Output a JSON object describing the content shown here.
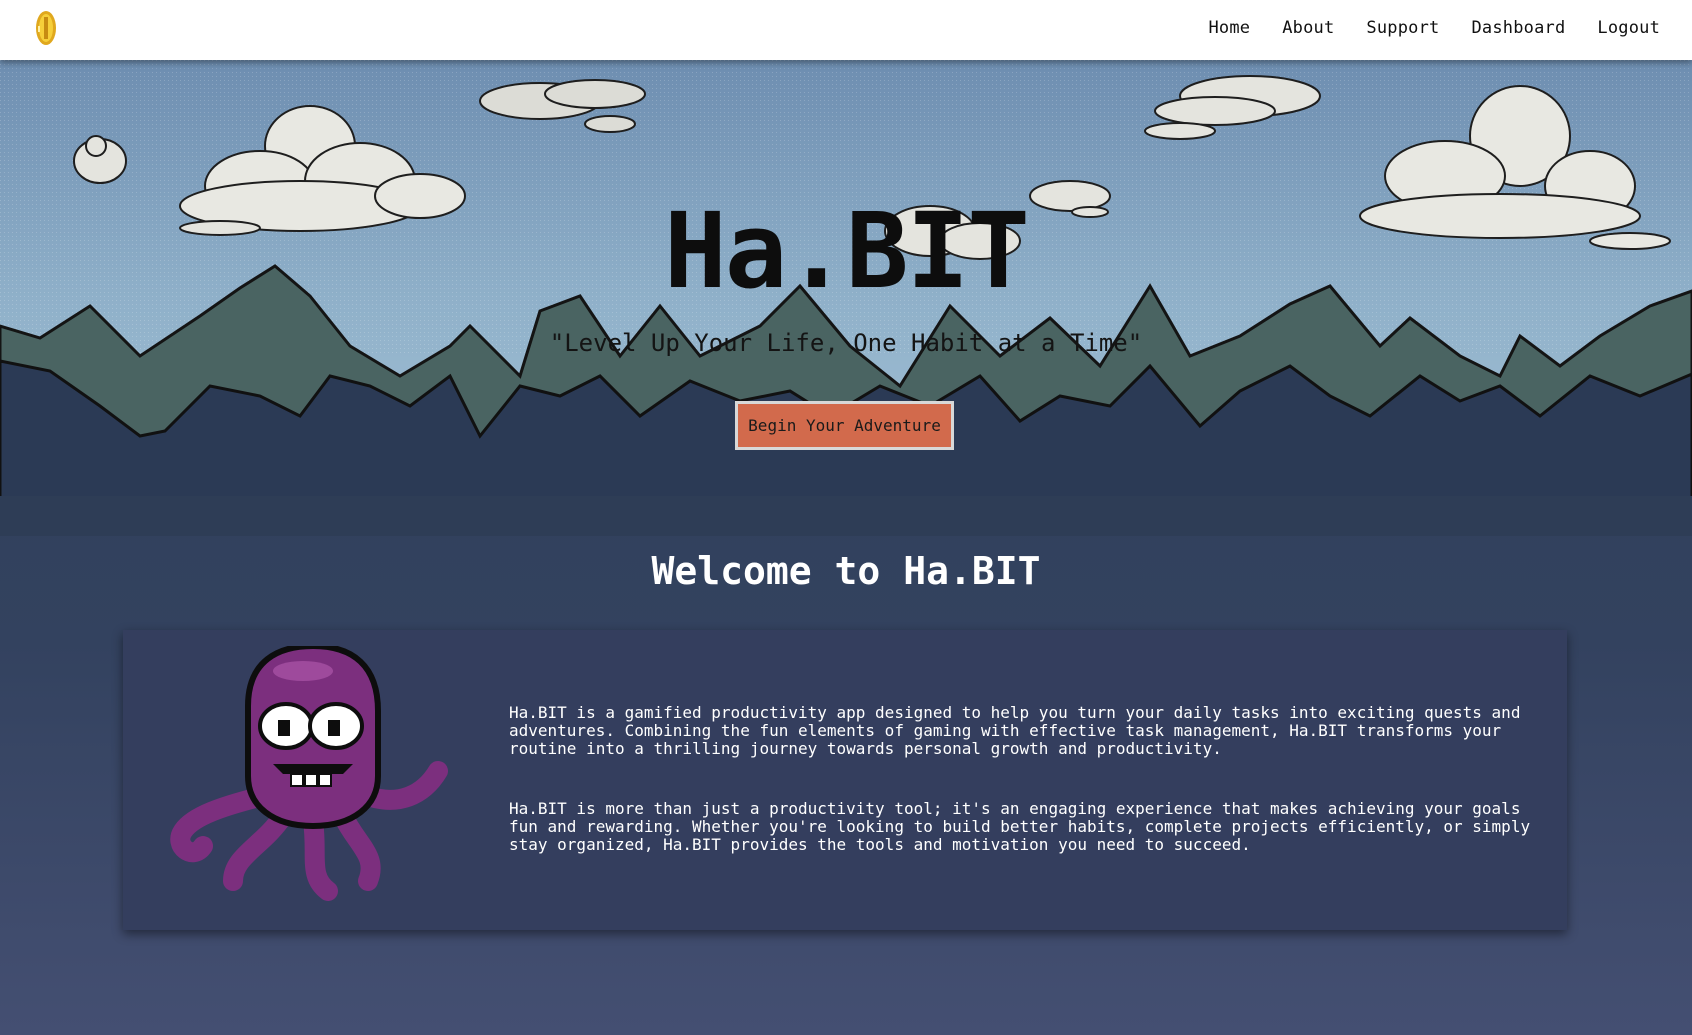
{
  "nav": {
    "logo_icon": "coin-icon",
    "links": [
      "Home",
      "About",
      "Support",
      "Dashboard",
      "Logout"
    ]
  },
  "hero": {
    "title": "Ha.BIT",
    "tagline": "\"Level Up Your Life, One Habit at a Time\"",
    "cta_label": "Begin Your Adventure"
  },
  "welcome": {
    "title": "Welcome to Ha.BIT",
    "mascot_icon": "purple-octopus-mascot",
    "paragraphs": [
      "Ha.BIT is a gamified productivity app designed to help you turn your daily tasks into exciting quests and adventures. Combining the fun elements of gaming with effective task management, Ha.BIT transforms your routine into a thrilling journey towards personal growth and productivity.",
      "Ha.BIT is more than just a productivity tool; it's an engaging experience that makes achieving your goals fun and rewarding. Whether you're looking to build better habits, complete projects efficiently, or simply stay organized, Ha.BIT provides the tools and motivation you need to succeed."
    ]
  },
  "colors": {
    "nav_bg": "#ffffff",
    "sky_top": "#6d8db0",
    "sky_bottom": "#a3c2d6",
    "mountain_back": "#4a6462",
    "mountain_front": "#2b3a55",
    "cta_bg": "#d26a4c",
    "card_bg": "#343e5e",
    "mascot": "#7c2f7e"
  }
}
